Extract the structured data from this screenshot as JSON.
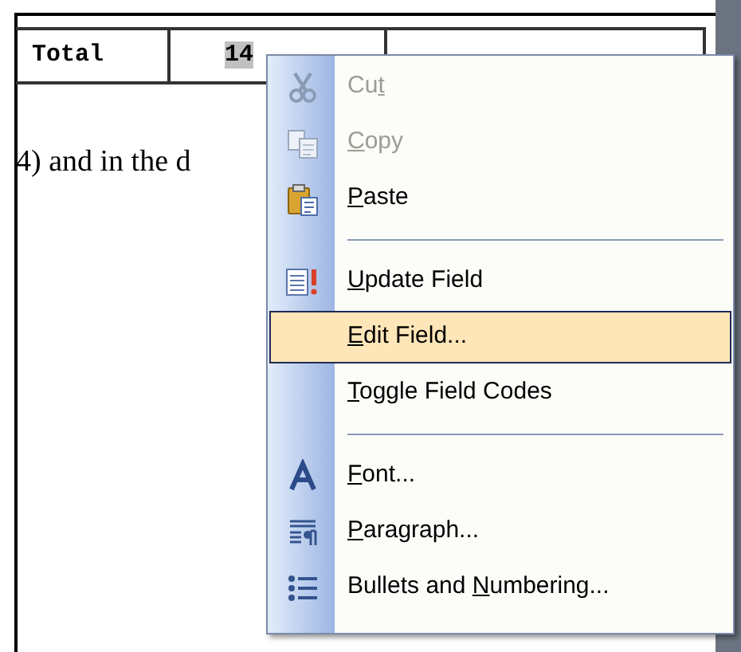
{
  "table": {
    "rows": [
      {
        "cells": [
          {
            "text": "Total",
            "kind": "label"
          },
          {
            "text": "14",
            "kind": "field"
          }
        ]
      }
    ]
  },
  "body_text": "4) and in the d",
  "context_menu": {
    "items": [
      {
        "kind": "item",
        "before": "Cu",
        "key": "t",
        "disabled": true,
        "selected": false
      },
      {
        "kind": "item",
        "key": "C",
        "after": "opy",
        "disabled": true,
        "selected": false
      },
      {
        "kind": "item",
        "key": "P",
        "after": "aste",
        "disabled": false,
        "selected": false
      },
      {
        "kind": "separator"
      },
      {
        "kind": "item",
        "key": "U",
        "after": "pdate Field",
        "disabled": false,
        "selected": false
      },
      {
        "kind": "item",
        "key": "E",
        "after": "dit Field...",
        "disabled": false,
        "selected": true
      },
      {
        "kind": "item",
        "key": "T",
        "after": "oggle Field Codes",
        "disabled": false,
        "selected": false
      },
      {
        "kind": "separator"
      },
      {
        "kind": "item",
        "key": "F",
        "after": "ont...",
        "disabled": false,
        "selected": false
      },
      {
        "kind": "item",
        "key": "P",
        "after": "aragraph...",
        "disabled": false,
        "selected": false
      },
      {
        "kind": "item",
        "before": "Bullets and ",
        "key": "N",
        "after": "umbering...",
        "disabled": false,
        "selected": false
      }
    ]
  }
}
